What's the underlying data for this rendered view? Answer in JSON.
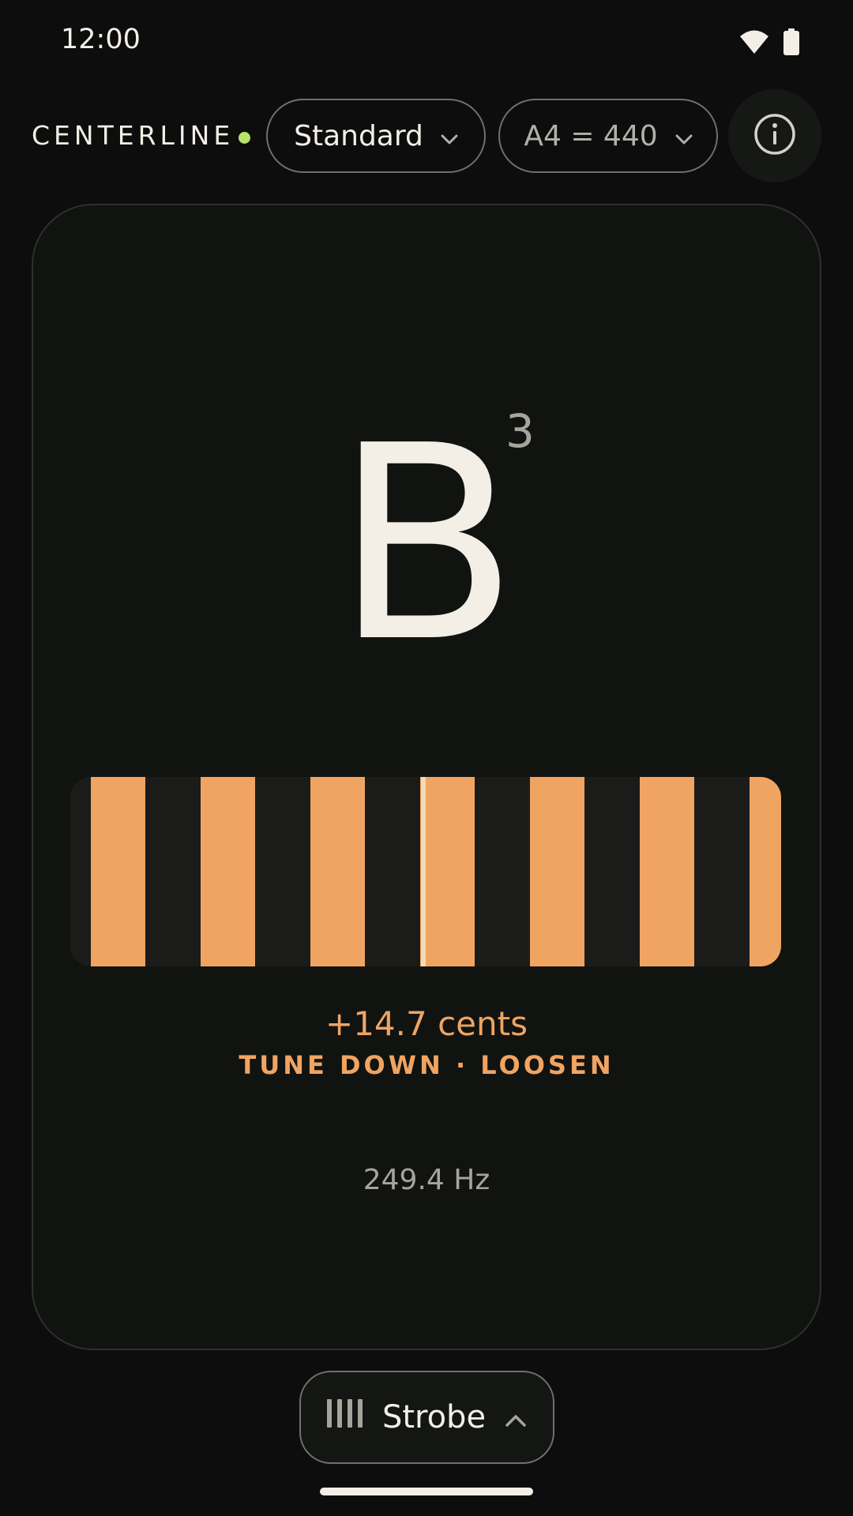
{
  "status_bar": {
    "time": "12:00",
    "icons": [
      "wifi-icon",
      "battery-icon"
    ]
  },
  "header": {
    "brand": "CENTERLINE",
    "brand_status_color": "#b7e36a",
    "tuning": {
      "label": "Standard",
      "icon": "chevron-down-icon"
    },
    "reference": {
      "label": "A4 = 440",
      "icon": "chevron-down-icon"
    },
    "info_icon": "info-icon"
  },
  "tuner": {
    "note": "B",
    "octave": "3",
    "cents": "+14.7 cents",
    "advice": "TUNE DOWN · LOOSEN",
    "frequency": "249.4 Hz",
    "accent_color": "#f0a462",
    "strobe_stripe_count": 7
  },
  "footer": {
    "mode_label": "Strobe",
    "mode_icon": "strobe-bars-icon",
    "mode_chevron": "chevron-up-icon"
  }
}
